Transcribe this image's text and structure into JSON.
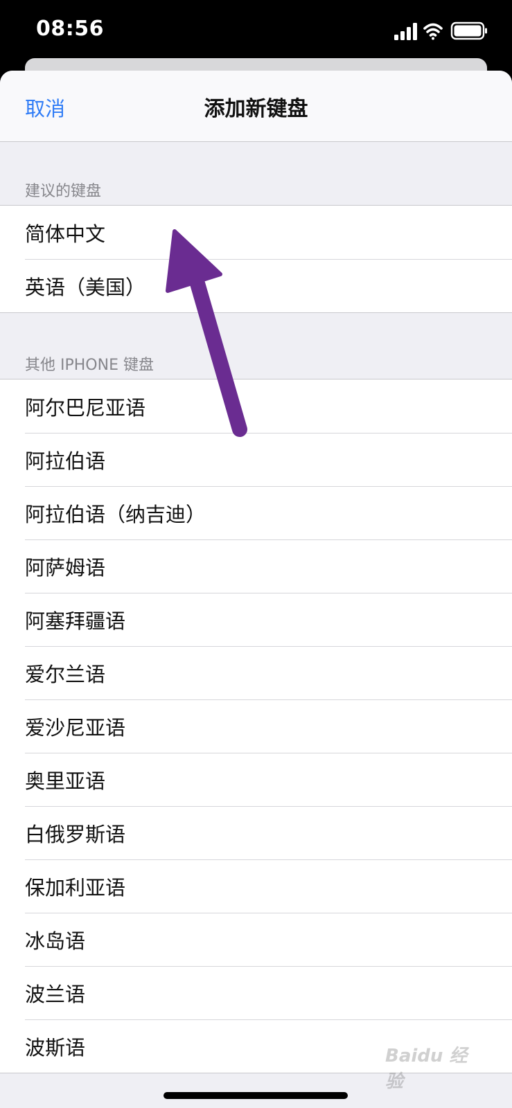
{
  "status_bar": {
    "time": "08:56"
  },
  "nav": {
    "cancel_label": "取消",
    "title": "添加新键盘"
  },
  "sections": {
    "suggested": {
      "header": "建议的键盘",
      "items": [
        "简体中文",
        "英语（美国）"
      ]
    },
    "other": {
      "header": "其他 IPHONE 键盘",
      "items": [
        "阿尔巴尼亚语",
        "阿拉伯语",
        "阿拉伯语（纳吉迪）",
        "阿萨姆语",
        "阿塞拜疆语",
        "爱尔兰语",
        "爱沙尼亚语",
        "奥里亚语",
        "白俄罗斯语",
        "保加利亚语",
        "冰岛语",
        "波兰语",
        "波斯语"
      ]
    }
  },
  "watermark": "Baidu 经验",
  "colors": {
    "accent": "#2f7cf6",
    "annotation_arrow": "#6a2c91"
  },
  "icons": [
    "signal-icon",
    "wifi-icon",
    "battery-icon",
    "annotation-arrow"
  ]
}
